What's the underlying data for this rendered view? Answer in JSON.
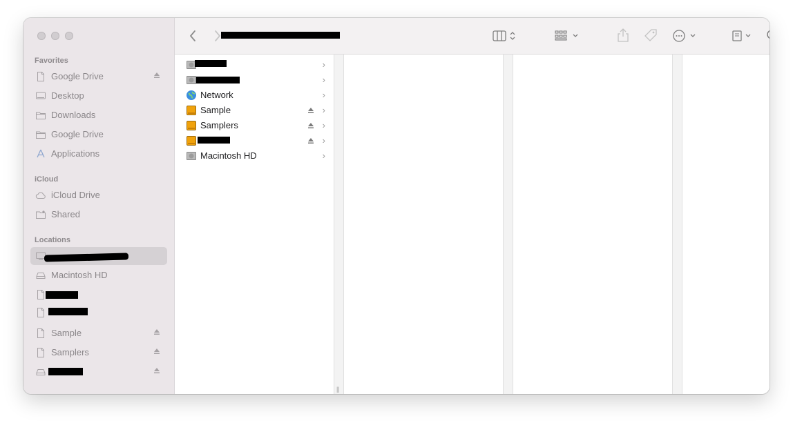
{
  "sidebar": {
    "sections": [
      {
        "title": "Favorites"
      },
      {
        "title": "iCloud"
      },
      {
        "title": "Locations"
      }
    ],
    "favorites": [
      {
        "label": "Google Drive",
        "icon": "document-icon",
        "eject": true
      },
      {
        "label": "Desktop",
        "icon": "desktop-icon",
        "eject": false
      },
      {
        "label": "Downloads",
        "icon": "folder-icon",
        "eject": false
      },
      {
        "label": "Google Drive",
        "icon": "folder-icon",
        "eject": false
      },
      {
        "label": "Applications",
        "icon": "applications-icon",
        "eject": false
      }
    ],
    "icloud": [
      {
        "label": "iCloud Drive",
        "icon": "cloud-icon"
      },
      {
        "label": "Shared",
        "icon": "shared-folder-icon"
      }
    ],
    "locations": [
      {
        "label": "",
        "icon": "computer-icon",
        "selected": true,
        "redacted": true
      },
      {
        "label": "Macintosh HD",
        "icon": "drive-icon"
      },
      {
        "label": "",
        "icon": "document-icon",
        "redacted": true
      },
      {
        "label": "",
        "icon": "document-icon",
        "redacted": true
      },
      {
        "label": "Sample",
        "icon": "document-icon",
        "eject": true
      },
      {
        "label": "Samplers",
        "icon": "document-icon",
        "eject": true
      },
      {
        "label": "",
        "icon": "drive-icon",
        "redacted": true,
        "eject": true
      }
    ]
  },
  "toolbar": {
    "title": "",
    "title_redacted": true
  },
  "browser": {
    "column1": [
      {
        "label": "",
        "icon": "hard-drive-icon",
        "redacted": true
      },
      {
        "label": "",
        "icon": "hard-drive-icon",
        "redacted": true
      },
      {
        "label": "Network",
        "icon": "network-globe-icon"
      },
      {
        "label": "Sample",
        "icon": "external-drive-icon",
        "eject": true
      },
      {
        "label": "Samplers",
        "icon": "external-drive-icon",
        "eject": true
      },
      {
        "label": "",
        "icon": "external-drive-icon",
        "eject": true,
        "redacted": true
      },
      {
        "label": "Macintosh HD",
        "icon": "hard-drive-icon"
      }
    ]
  },
  "colors": {
    "sidebar_bg": "#ebe6e9",
    "selection": "#d5d1d4",
    "toolbar_bg": "#f3f1f2",
    "drive_orange": "#f0a20c"
  }
}
